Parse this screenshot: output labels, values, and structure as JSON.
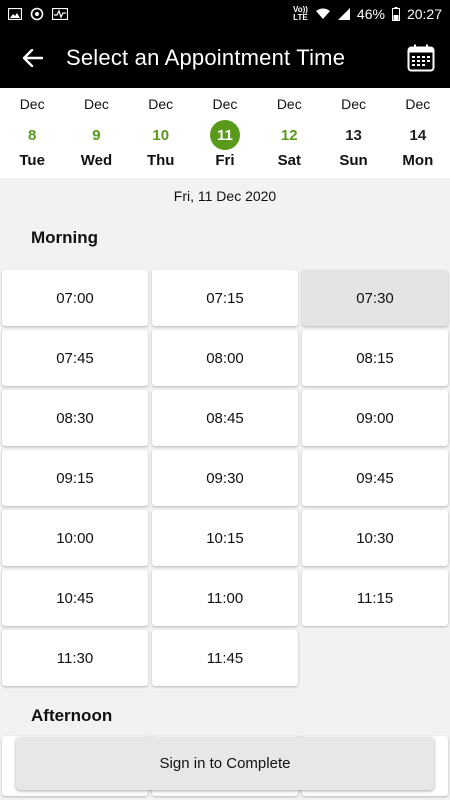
{
  "status_bar": {
    "volte_top": "Vo))",
    "volte_bottom": "LTE",
    "battery": "46%",
    "time": "20:27"
  },
  "app_bar": {
    "title": "Select an Appointment Time"
  },
  "date_strip": {
    "days": [
      {
        "month": "Dec",
        "day": "8",
        "weekday": "Tue"
      },
      {
        "month": "Dec",
        "day": "9",
        "weekday": "Wed"
      },
      {
        "month": "Dec",
        "day": "10",
        "weekday": "Thu"
      },
      {
        "month": "Dec",
        "day": "11",
        "weekday": "Fri"
      },
      {
        "month": "Dec",
        "day": "12",
        "weekday": "Sat"
      },
      {
        "month": "Dec",
        "day": "13",
        "weekday": "Sun"
      },
      {
        "month": "Dec",
        "day": "14",
        "weekday": "Mon"
      }
    ]
  },
  "selected_date": "Fri, 11 Dec 2020",
  "morning": {
    "title": "Morning",
    "slots": [
      "07:00",
      "07:15",
      "07:30",
      "07:45",
      "08:00",
      "08:15",
      "08:30",
      "08:45",
      "09:00",
      "09:15",
      "09:30",
      "09:45",
      "10:00",
      "10:15",
      "10:30",
      "10:45",
      "11:00",
      "11:15",
      "11:30",
      "11:45"
    ]
  },
  "afternoon": {
    "title": "Afternoon"
  },
  "sign_in_button": "Sign in to Complete",
  "colors": {
    "accent": "#5a9a1a",
    "bar": "#000000",
    "selected_slot": "#e4e4e4"
  }
}
